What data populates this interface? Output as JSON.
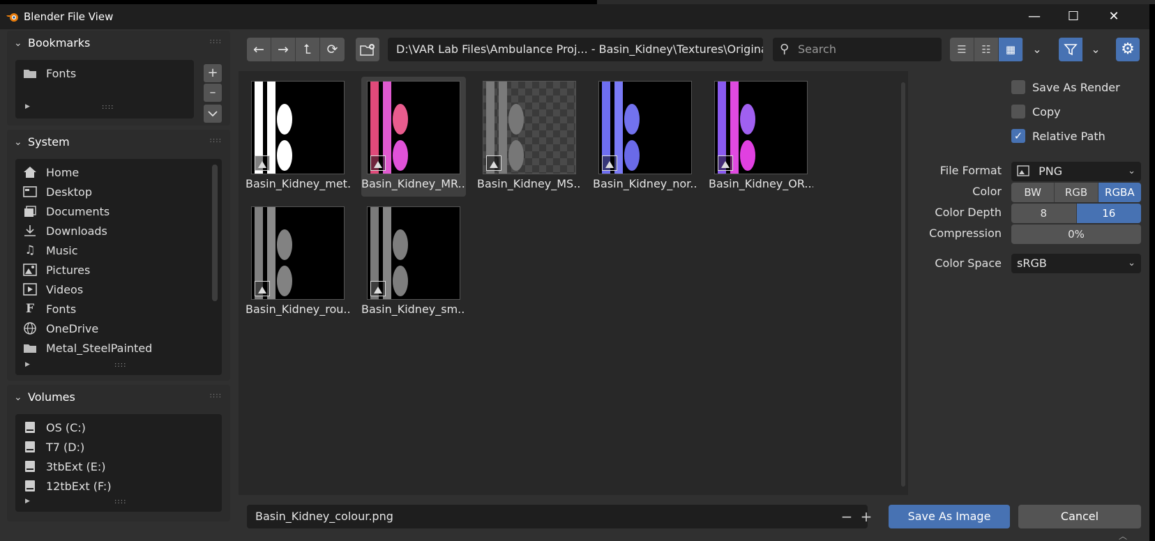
{
  "window": {
    "title": "Blender File View",
    "minimize_label": "—",
    "maximize_label": "☐",
    "close_label": "✕"
  },
  "sidebar": {
    "bookmarks": {
      "title": "Bookmarks",
      "items": [
        {
          "label": "Fonts",
          "icon": "folder-icon"
        }
      ],
      "add_label": "+",
      "remove_label": "–",
      "more_label": "⌄"
    },
    "system": {
      "title": "System",
      "items": [
        {
          "label": "Home",
          "icon": "home-icon"
        },
        {
          "label": "Desktop",
          "icon": "desktop-icon"
        },
        {
          "label": "Documents",
          "icon": "documents-icon"
        },
        {
          "label": "Downloads",
          "icon": "downloads-icon"
        },
        {
          "label": "Music",
          "icon": "music-icon"
        },
        {
          "label": "Pictures",
          "icon": "pictures-icon"
        },
        {
          "label": "Videos",
          "icon": "videos-icon"
        },
        {
          "label": "Fonts",
          "icon": "font-icon"
        },
        {
          "label": "OneDrive",
          "icon": "globe-icon"
        },
        {
          "label": "Metal_SteelPainted",
          "icon": "folder-icon"
        }
      ]
    },
    "volumes": {
      "title": "Volumes",
      "items": [
        {
          "label": "OS (C:)",
          "icon": "drive-icon"
        },
        {
          "label": "T7 (D:)",
          "icon": "drive-icon"
        },
        {
          "label": "3tbExt (E:)",
          "icon": "drive-icon"
        },
        {
          "label": "12tbExt (F:)",
          "icon": "drive-icon"
        }
      ]
    }
  },
  "toolbar": {
    "path": "D:\\VAR Lab Files\\Ambulance Proj... - Basin_Kidney\\Textures\\Original\\",
    "search_placeholder": "Search"
  },
  "files": [
    {
      "name": "Basin_Kidney_met...",
      "selected": false,
      "style": "metallic"
    },
    {
      "name": "Basin_Kidney_MR...",
      "selected": true,
      "style": "mr"
    },
    {
      "name": "Basin_Kidney_MS....",
      "selected": false,
      "style": "ms"
    },
    {
      "name": "Basin_Kidney_nor...",
      "selected": false,
      "style": "normal"
    },
    {
      "name": "Basin_Kidney_OR...",
      "selected": false,
      "style": "or"
    },
    {
      "name": "Basin_Kidney_rou...",
      "selected": false,
      "style": "rough"
    },
    {
      "name": "Basin_Kidney_sm...",
      "selected": false,
      "style": "smooth"
    }
  ],
  "bottom": {
    "filename": "Basin_Kidney_colour.png",
    "minus_label": "−",
    "plus_label": "+",
    "save_label": "Save As Image",
    "cancel_label": "Cancel"
  },
  "options": {
    "save_as_render": {
      "label": "Save As Render",
      "checked": false
    },
    "copy": {
      "label": "Copy",
      "checked": false
    },
    "relative_path": {
      "label": "Relative Path",
      "checked": true
    },
    "file_format_label": "File Format",
    "file_format_value": "PNG",
    "color_label": "Color",
    "color_options": [
      "BW",
      "RGB",
      "RGBA"
    ],
    "color_selected": "RGBA",
    "color_depth_label": "Color Depth",
    "color_depth_options": [
      "8",
      "16"
    ],
    "color_depth_selected": "16",
    "compression_label": "Compression",
    "compression_value": "0%",
    "color_space_label": "Color Space",
    "color_space_value": "sRGB"
  },
  "colors": {
    "accent": "#4772b3",
    "window_bg": "#303030",
    "panel_bg": "#2c2c2c",
    "field_bg": "#1e1e1e",
    "button_bg": "#545454"
  }
}
